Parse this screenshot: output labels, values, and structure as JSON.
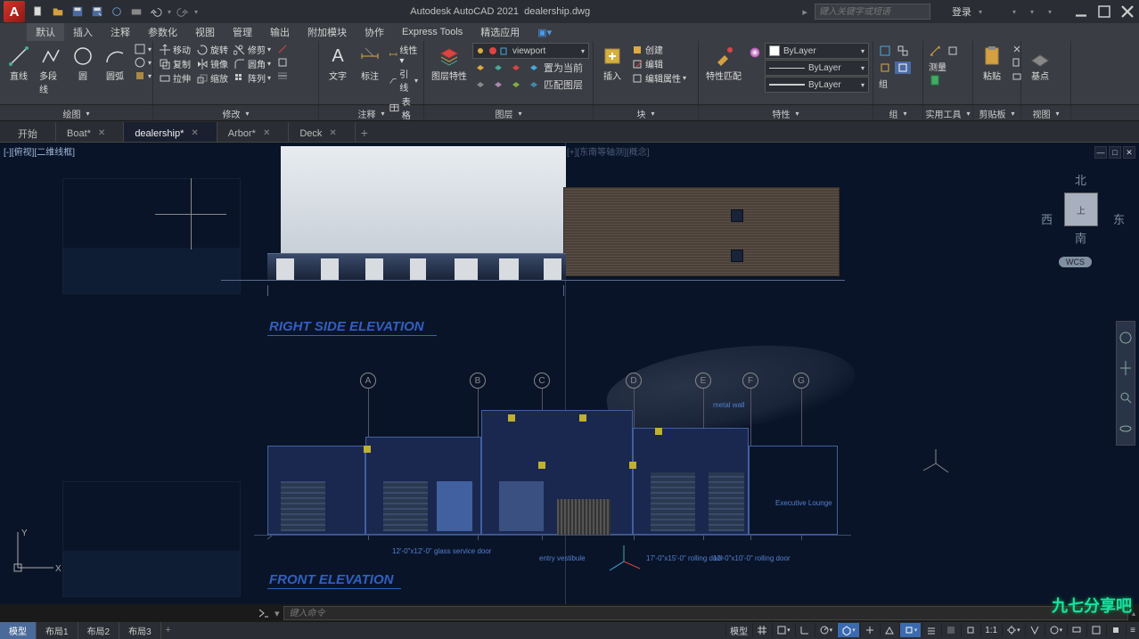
{
  "title": {
    "app": "Autodesk AutoCAD 2021",
    "file": "dealership.dwg"
  },
  "search": {
    "placeholder": "键入关键字或短语"
  },
  "account": {
    "label": "登录"
  },
  "menu": {
    "items": [
      "默认",
      "插入",
      "注释",
      "参数化",
      "视图",
      "管理",
      "输出",
      "附加模块",
      "协作",
      "Express Tools",
      "精选应用"
    ]
  },
  "ribbon": {
    "draw": {
      "line": "直线",
      "pline": "多段线",
      "circle": "圆",
      "arc": "圆弧",
      "footer": "绘图"
    },
    "modify": {
      "move": "移动",
      "rotate": "旋转",
      "trim": "修剪",
      "copy": "复制",
      "mirror": "镜像",
      "fillet": "圆角",
      "stretch": "拉伸",
      "scale": "缩放",
      "array": "阵列",
      "footer": "修改"
    },
    "anno": {
      "text": "文字",
      "dim": "标注",
      "leader": "引线",
      "table": "表格",
      "footer": "注释"
    },
    "layer": {
      "prop": "图层特性",
      "dd": "viewport",
      "cur": "置为当前",
      "match": "匹配图层",
      "footer": "图层"
    },
    "block": {
      "insert": "插入",
      "create": "创建",
      "edit": "编辑",
      "attr": "编辑属性",
      "footer": "块"
    },
    "prop": {
      "match": "特性匹配",
      "layer": "ByLayer",
      "lt": "ByLayer",
      "lw": "ByLayer",
      "footer": "特性"
    },
    "group": {
      "footer": "组"
    },
    "util": {
      "footer": "实用工具"
    },
    "clip": {
      "paste": "粘贴",
      "footer": "剪贴板"
    },
    "view": {
      "base": "基点",
      "footer": "视图"
    }
  },
  "filetabs": {
    "start": "开始",
    "items": [
      "Boat*",
      "dealership*",
      "Arbor*",
      "Deck"
    ]
  },
  "viewport": {
    "left": "[-][俯视][二维线框]",
    "right": "[+][东南等轴测][概念]"
  },
  "drawing": {
    "title1": "RIGHT SIDE ELEVATION",
    "title2": "FRONT ELEVATION",
    "grids": [
      "A",
      "B",
      "C",
      "D",
      "E",
      "F",
      "G"
    ],
    "anno1": "metal wall",
    "anno2": "Executive Lounge",
    "anno3": "entry vestibule",
    "anno4": "12'-0\"x12'-0\" glass service door",
    "anno5": "17'-0\"x15'-0\" rolling door",
    "anno6": "12'-0\"x10'-0\" rolling door"
  },
  "nav": {
    "n": "北",
    "s": "南",
    "e": "东",
    "w": "西",
    "top": "上",
    "wcs": "WCS"
  },
  "cmd": {
    "placeholder": "键入命令"
  },
  "btabs": {
    "items": [
      "模型",
      "布局1",
      "布局2",
      "布局3"
    ]
  },
  "status": {
    "model": "模型",
    "scale": "1:1"
  },
  "watermark": "九七分享吧"
}
